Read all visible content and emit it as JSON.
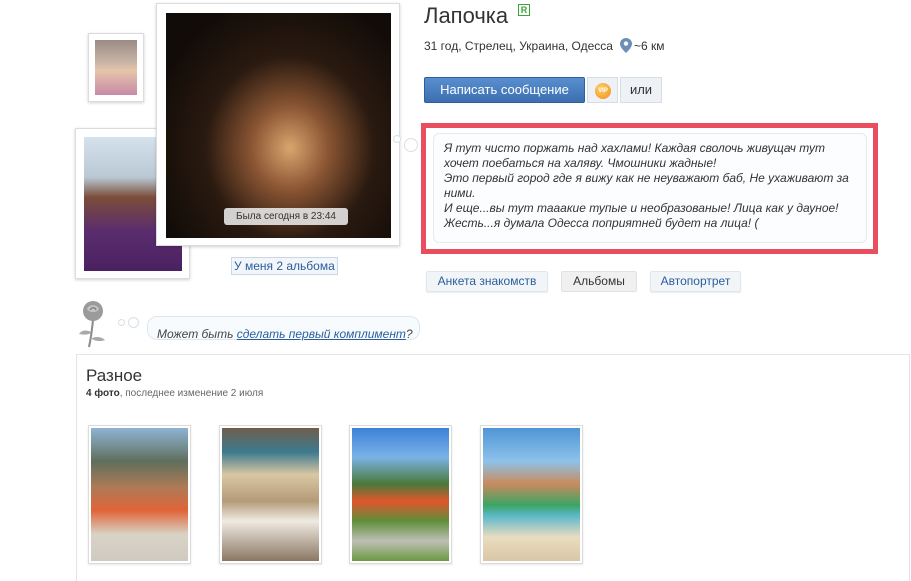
{
  "profile": {
    "name": "Лапочка",
    "registered_badge": "R",
    "info": "31 год, Стрелец, Украина, Одесса",
    "distance": "~6 км",
    "last_seen": "Была сегодня в 23:44",
    "albums_link": "У меня 2 альбома"
  },
  "actions": {
    "write_message": "Написать сообщение",
    "vip_label": "VIP",
    "or_label": "или"
  },
  "status": {
    "lines": [
      "Я тут чисто поржать над хахлами! Каждая сволочь живущач тут",
      "хочет поебаться на халяву. Чмошники жадные!",
      "Это первый город где я вижу как не неуважают баб, Не ухаживают за",
      "ними.",
      "И еще...вы тут тааакие тупые и необразованые! Лица как у дауное!",
      "Жесть...я думала Одесса поприятней будет на лица! ("
    ]
  },
  "tabs": [
    {
      "label": "Анкета знакомств"
    },
    {
      "label": "Альбомы"
    },
    {
      "label": "Автопортрет"
    }
  ],
  "compliment": {
    "prefix": "Может быть ",
    "link": "сделать первый комплимент",
    "suffix": "?"
  },
  "album": {
    "title": "Разное",
    "photo_count": "4 фото",
    "meta": ", последнее изменение 2 июля"
  },
  "colors": {
    "accent": "#3b6fb0",
    "link": "#2a5d9c",
    "highlight_border": "#e94e5f",
    "registered_green": "#3aa53a"
  }
}
